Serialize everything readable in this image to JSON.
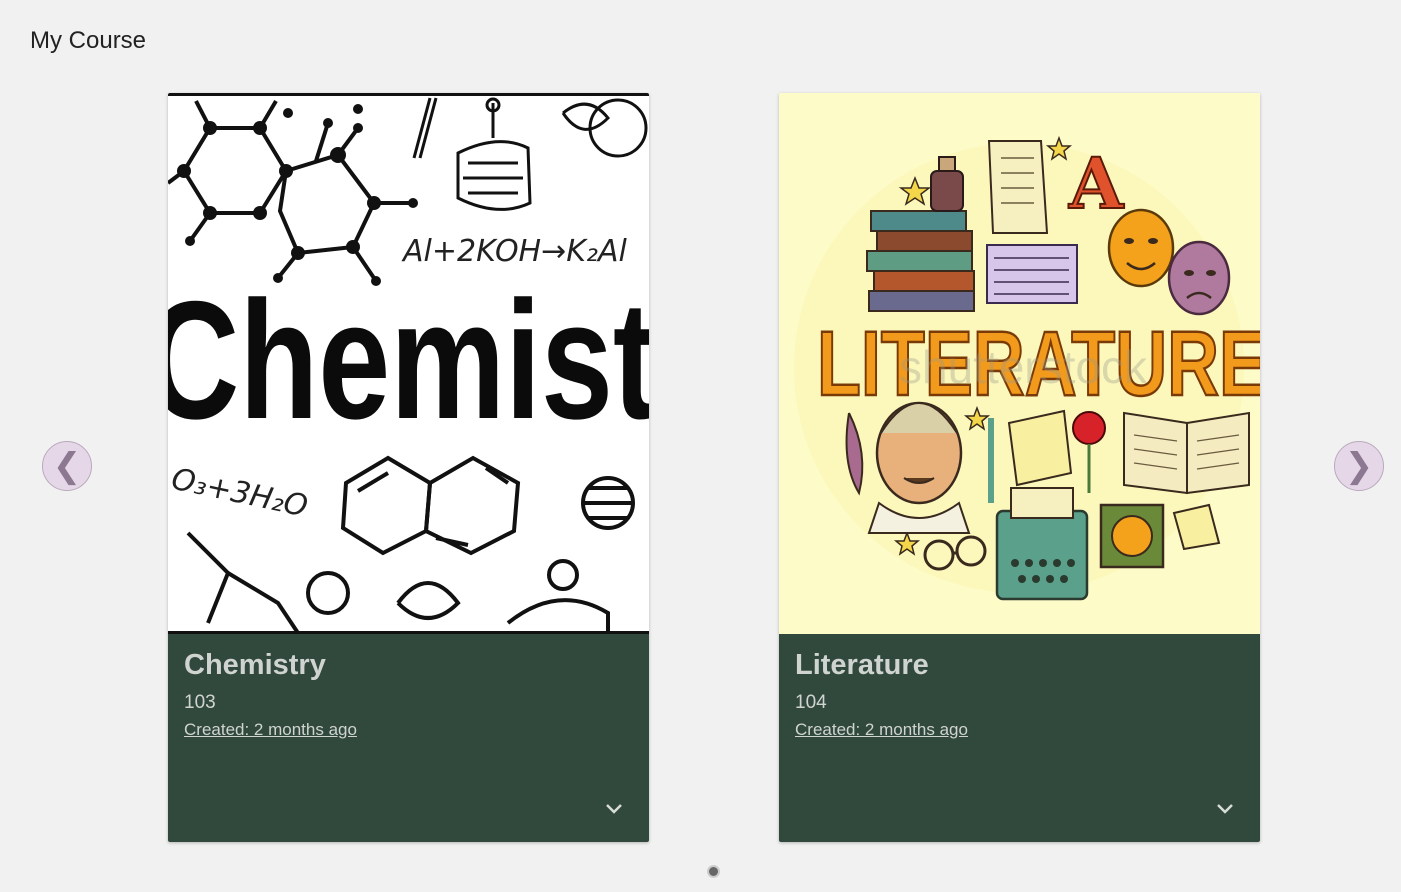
{
  "header": {
    "title": "My Course"
  },
  "carousel": {
    "prev_icon": "chevron-left-icon",
    "prev_glyph": "❮",
    "next_icon": "chevron-right-icon",
    "next_glyph": "❯",
    "accent": "#e6d7e8",
    "courses": [
      {
        "title": "Chemistry",
        "number": "103",
        "created": "Created: 2 months ago",
        "image": {
          "kind": "chemistry-illustration",
          "text": "Chemist",
          "formula_1": "Al+2KOH→K₂Al",
          "formula_2": "O₃+3H₂O"
        }
      },
      {
        "title": "Literature",
        "number": "104",
        "created": "Created: 2 months ago",
        "image": {
          "kind": "literature-illustration",
          "text": "LITERATURE",
          "letter": "A",
          "watermark": "shutterstock"
        }
      }
    ],
    "card_color": "#31483c",
    "expand_icon": "chevron-down-icon"
  }
}
